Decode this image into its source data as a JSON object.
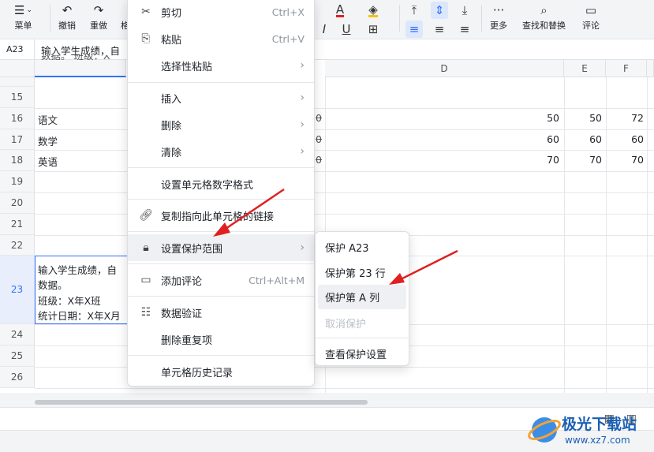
{
  "toolbar": {
    "menu_label": "菜单",
    "undo_label": "撤销",
    "redo_label": "重做",
    "cut_partial_label": "格",
    "more_label": "更多",
    "find_label": "查找和替换",
    "comment_label": "评论"
  },
  "formula_bar": {
    "cell_ref": "A23",
    "content": "输入学生成绩，自",
    "content_line2": "数据。 班级：X"
  },
  "columns": {
    "d": "D",
    "e": "E",
    "f": "F"
  },
  "rows": [
    {
      "num": "15",
      "label": "",
      "c": "",
      "d": "",
      "e": "",
      "f": ""
    },
    {
      "num": "16",
      "label": "语文",
      "c": "0",
      "d": "50",
      "e": "50",
      "f": "72"
    },
    {
      "num": "17",
      "label": "数学",
      "c": "0",
      "d": "60",
      "e": "60",
      "f": "60"
    },
    {
      "num": "18",
      "label": "英语",
      "c": "0",
      "d": "70",
      "e": "70",
      "f": "70"
    },
    {
      "num": "19"
    },
    {
      "num": "20"
    },
    {
      "num": "21"
    },
    {
      "num": "22"
    },
    {
      "num": "23"
    },
    {
      "num": "24"
    },
    {
      "num": "25"
    },
    {
      "num": "26"
    }
  ],
  "selected_cell_lines": [
    "输入学生成绩，自",
    "数据。",
    "班级：X年X班",
    "统计日期：X年X月"
  ],
  "context_menu": {
    "cut": {
      "label": "剪切",
      "shortcut": "Ctrl+X"
    },
    "paste": {
      "label": "粘贴",
      "shortcut": "Ctrl+V"
    },
    "paste_special": {
      "label": "选择性粘贴"
    },
    "insert": {
      "label": "插入"
    },
    "delete": {
      "label": "删除"
    },
    "clear": {
      "label": "清除"
    },
    "number_format": {
      "label": "设置单元格数字格式"
    },
    "copy_link": {
      "label": "复制指向此单元格的链接"
    },
    "protect_range": {
      "label": "设置保护范围"
    },
    "add_comment": {
      "label": "添加评论",
      "shortcut": "Ctrl+Alt+M"
    },
    "data_validation": {
      "label": "数据验证"
    },
    "remove_duplicates": {
      "label": "删除重复项"
    },
    "cell_history": {
      "label": "单元格历史记录"
    }
  },
  "protect_submenu": {
    "protect_cell": "保护 A23",
    "protect_row": "保护第 23 行",
    "protect_column": "保护第 A 列",
    "unprotect": "取消保护",
    "view_settings": "查看保护设置"
  },
  "watermark": {
    "text": "极光下载站",
    "url": "www.xz7.com"
  },
  "colors": {
    "accent": "#3370ff",
    "arrow": "#e02020"
  }
}
